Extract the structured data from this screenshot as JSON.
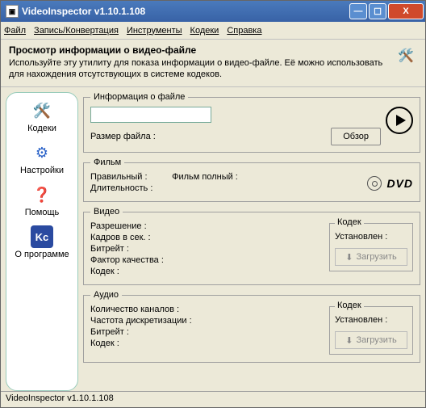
{
  "window": {
    "title": "VideoInspector v1.10.1.108"
  },
  "menu": {
    "file": "Файл",
    "record": "Запись/Конвертация",
    "tools": "Инструменты",
    "codecs": "Кодеки",
    "help": "Справка"
  },
  "header": {
    "title": "Просмотр информации о видео-файле",
    "desc": "Используйте эту утилиту для показа информации о видео-файле. Её можно использовать для нахождения отсутствующих в системе кодеков."
  },
  "sidebar": {
    "codecs": "Кодеки",
    "settings": "Настройки",
    "help": "Помощь",
    "about": "О программе"
  },
  "fileinfo": {
    "legend": "Информация о файле",
    "path": "",
    "size_label": "Размер файла :",
    "browse": "Обзор"
  },
  "film": {
    "legend": "Фильм",
    "valid": "Правильный :",
    "complete": "Фильм полный :",
    "duration": "Длительность :",
    "dvd": "DVD"
  },
  "video": {
    "legend": "Видео",
    "resolution": "Разрешение :",
    "fps": "Кадров в сек. :",
    "bitrate": "Битрейт :",
    "quality": "Фактор качества :",
    "codec": "Кодек :",
    "codec_box": {
      "legend": "Кодек",
      "installed": "Установлен :",
      "download": "Загрузить"
    }
  },
  "audio": {
    "legend": "Аудио",
    "channels": "Количество каналов :",
    "samplerate": "Частота дискретизации :",
    "bitrate": "Битрейт :",
    "codec": "Кодек :",
    "codec_box": {
      "legend": "Кодек",
      "installed": "Установлен :",
      "download": "Загрузить"
    }
  },
  "status": {
    "text": "VideoInspector v1.10.1.108"
  }
}
